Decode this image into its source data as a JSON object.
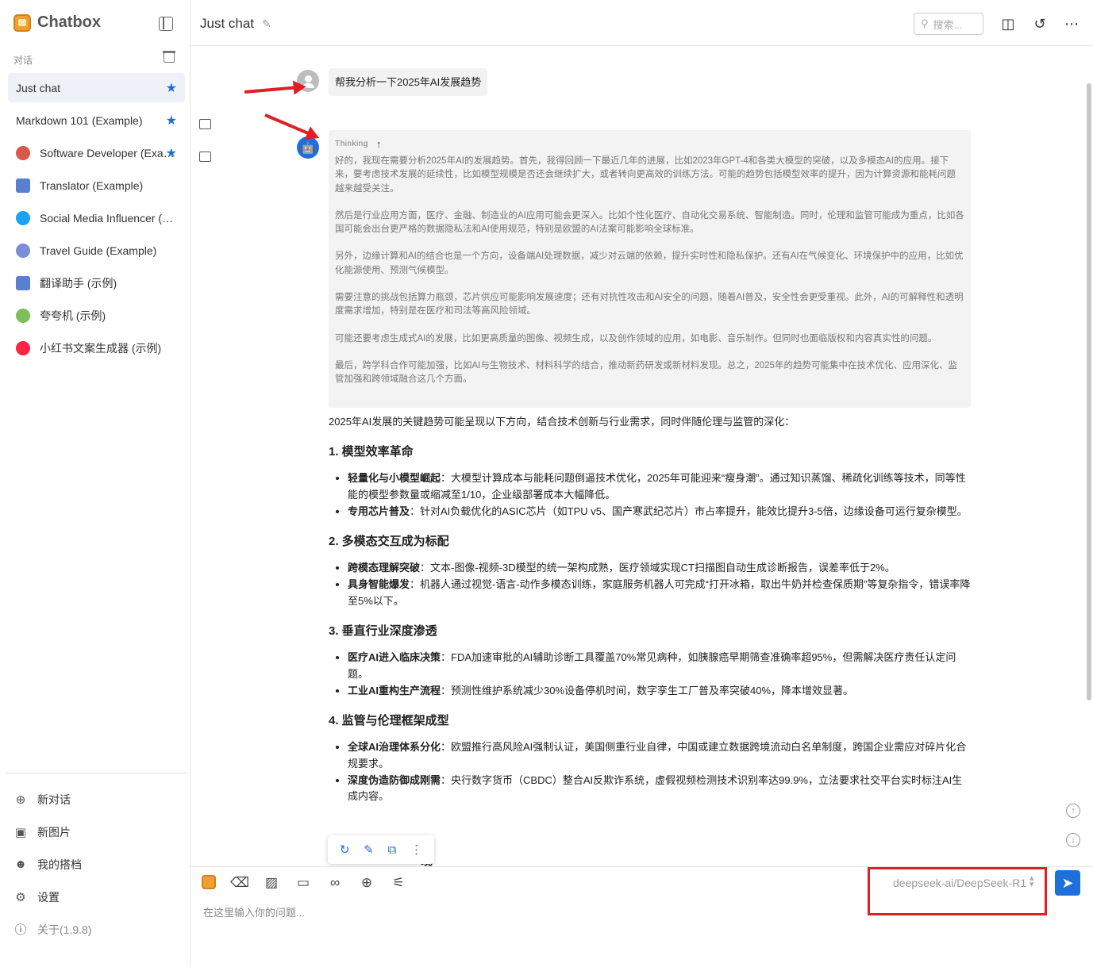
{
  "app": {
    "name": "Chatbox",
    "section_label": "对话"
  },
  "conversations": [
    {
      "label": "Just chat",
      "icon": "chat-bubble-icon",
      "starred": true,
      "active": true
    },
    {
      "label": "Markdown 101 (Example)",
      "icon": "chat-bubble-icon",
      "starred": true,
      "active": false
    },
    {
      "label": "Software Developer (Example)",
      "icon": "developer-avatar-icon",
      "starred": true,
      "active": false
    },
    {
      "label": "Translator (Example)",
      "icon": "translator-avatar-icon",
      "starred": false,
      "active": false
    },
    {
      "label": "Social Media Influencer (Example)",
      "icon": "twitter-avatar-icon",
      "starred": false,
      "active": false
    },
    {
      "label": "Travel Guide (Example)",
      "icon": "globe-avatar-icon",
      "starred": false,
      "active": false
    },
    {
      "label": "翻译助手 (示例)",
      "icon": "translator-avatar-icon",
      "starred": false,
      "active": false
    },
    {
      "label": "夸夸机 (示例)",
      "icon": "praise-avatar-icon",
      "starred": false,
      "active": false
    },
    {
      "label": "小红书文案生成器 (示例)",
      "icon": "xiaohongshu-avatar-icon",
      "starred": false,
      "active": false
    }
  ],
  "side_menu": {
    "new_chat": "新对话",
    "new_image": "新图片",
    "my_copilots": "我的搭档",
    "settings": "设置",
    "about": "关于(1.9.8)"
  },
  "header": {
    "title": "Just chat",
    "search_placeholder": "搜索..."
  },
  "messages": {
    "user": "帮我分析一下2025年AI发展趋势",
    "thinking_label": "Thinking",
    "thinking_paragraphs": [
      "好的，我现在需要分析2025年AI的发展趋势。首先，我得回顾一下最近几年的进展，比如2023年GPT-4和各类大模型的突破，以及多模态AI的应用。接下来，要考虑技术发展的延续性，比如模型规模是否还会继续扩大，或者转向更高效的训练方法。可能的趋势包括模型效率的提升，因为计算资源和能耗问题越来越受关注。",
      "然后是行业应用方面，医疗、金融、制造业的AI应用可能会更深入。比如个性化医疗、自动化交易系统、智能制造。同时，伦理和监管可能成为重点，比如各国可能会出台更严格的数据隐私法和AI使用规范，特别是欧盟的AI法案可能影响全球标准。",
      "另外，边缘计算和AI的结合也是一个方向，设备端AI处理数据，减少对云端的依赖，提升实时性和隐私保护。还有AI在气候变化、环境保护中的应用，比如优化能源使用、预测气候模型。",
      "需要注意的挑战包括算力瓶颈，芯片供应可能影响发展速度；还有对抗性攻击和AI安全的问题，随着AI普及，安全性会更受重视。此外，AI的可解释性和透明度需求增加，特别是在医疗和司法等高风险领域。",
      "可能还要考虑生成式AI的发展，比如更高质量的图像、视频生成，以及创作领域的应用，如电影、音乐制作。但同时也面临版权和内容真实性的问题。",
      "最后，跨学科合作可能加强，比如AI与生物技术、材料科学的结合，推动新药研发或新材料发现。总之，2025年的趋势可能集中在技术优化、应用深化、监管加强和跨领域融合这几个方面。"
    ],
    "answer_intro": "2025年AI发展的关键趋势可能呈现以下方向，结合技术创新与行业需求，同时伴随伦理与监管的深化：",
    "sections": [
      {
        "heading": "1. 模型效率革命",
        "items": [
          {
            "bold": "轻量化与小模型崛起",
            "text": "：大模型计算成本与能耗问题倒逼技术优化，2025年可能迎来“瘦身潮”。通过知识蒸馏、稀疏化训练等技术，同等性能的模型参数量或缩减至1/10，企业级部署成本大幅降低。"
          },
          {
            "bold": "专用芯片普及",
            "text": "：针对AI负载优化的ASIC芯片（如TPU v5、国产寒武纪芯片）市占率提升，能效比提升3-5倍，边缘设备可运行复杂模型。"
          }
        ]
      },
      {
        "heading": "2. 多模态交互成为标配",
        "items": [
          {
            "bold": "跨模态理解突破",
            "text": "：文本-图像-视频-3D模型的统一架构成熟，医疗领域实现CT扫描图自动生成诊断报告，误差率低于2%。"
          },
          {
            "bold": "具身智能爆发",
            "text": "：机器人通过视觉-语言-动作多模态训练，家庭服务机器人可完成“打开冰箱，取出牛奶并检查保质期”等复杂指令，错误率降至5%以下。"
          }
        ]
      },
      {
        "heading": "3. 垂直行业深度渗透",
        "items": [
          {
            "bold": "医疗AI进入临床决策",
            "text": "：FDA加速审批的AI辅助诊断工具覆盖70%常见病种，如胰腺癌早期筛查准确率超95%，但需解决医疗责任认定问题。"
          },
          {
            "bold": "工业AI重构生产流程",
            "text": "：预测性维护系统减少30%设备停机时间，数字孪生工厂普及率突破40%，降本增效显著。"
          }
        ]
      },
      {
        "heading": "4. 监管与伦理框架成型",
        "items": [
          {
            "bold": "全球AI治理体系分化",
            "text": "：欧盟推行高风险AI强制认证，美国侧重行业自律，中国或建立数据跨境流动白名单制度，跨国企业需应对碎片化合规要求。"
          },
          {
            "bold": "深度伪造防御成刚需",
            "text": "：央行数字货币（CBDC）整合AI反欺诈系统，虚假视频检测技术识别率达99.9%，立法要求社交平台实时标注AI生成内容。"
          }
        ]
      }
    ],
    "partial_heading": "现"
  },
  "input": {
    "placeholder": "在这里输入你的问题...",
    "model": "deepseek-ai/DeepSeek-R1"
  },
  "colors": {
    "accent": "#1e6fd9",
    "annotation_red": "#e01e26",
    "thinking_bg": "#f3f3f3"
  }
}
